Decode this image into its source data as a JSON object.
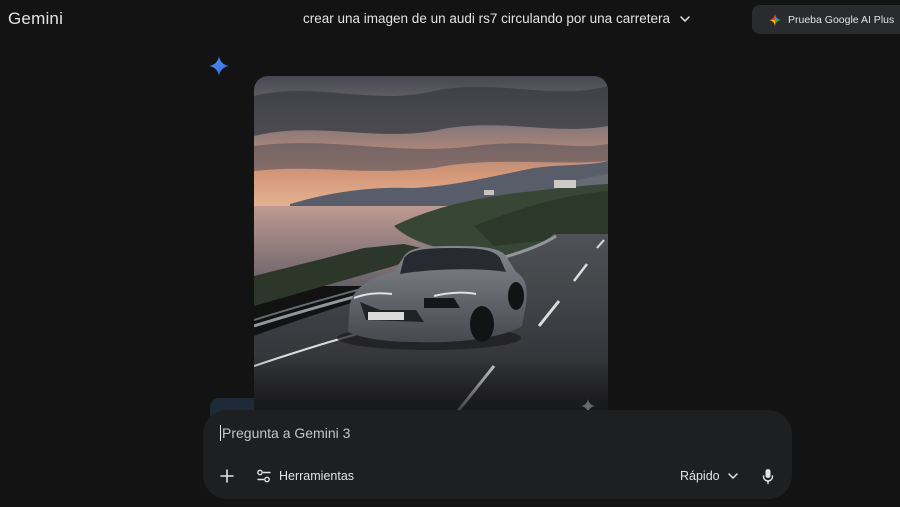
{
  "header": {
    "app_title": "Gemini",
    "conversation_title": "crear una imagen de un audi rs7 circulando por una carretera",
    "upgrade_label": "Prueba Google AI Plus"
  },
  "response": {
    "image_type": "generated-image",
    "image_content_icon": "car-on-coastal-road"
  },
  "prompt": {
    "placeholder": "Pregunta a Gemini 3",
    "value": "",
    "add_icon": "plus-icon",
    "tools_label": "Herramientas",
    "tools_icon": "sliders-icon",
    "mode_label": "Rápido",
    "mode_icon": "chevron-down-icon",
    "mic_icon": "microphone-icon"
  },
  "colors": {
    "background": "#131314",
    "surface": "#1e1f20",
    "upgrade_bg": "#2a2b2e",
    "accent_blue": "#4285f4",
    "text": "#e3e3e3"
  }
}
